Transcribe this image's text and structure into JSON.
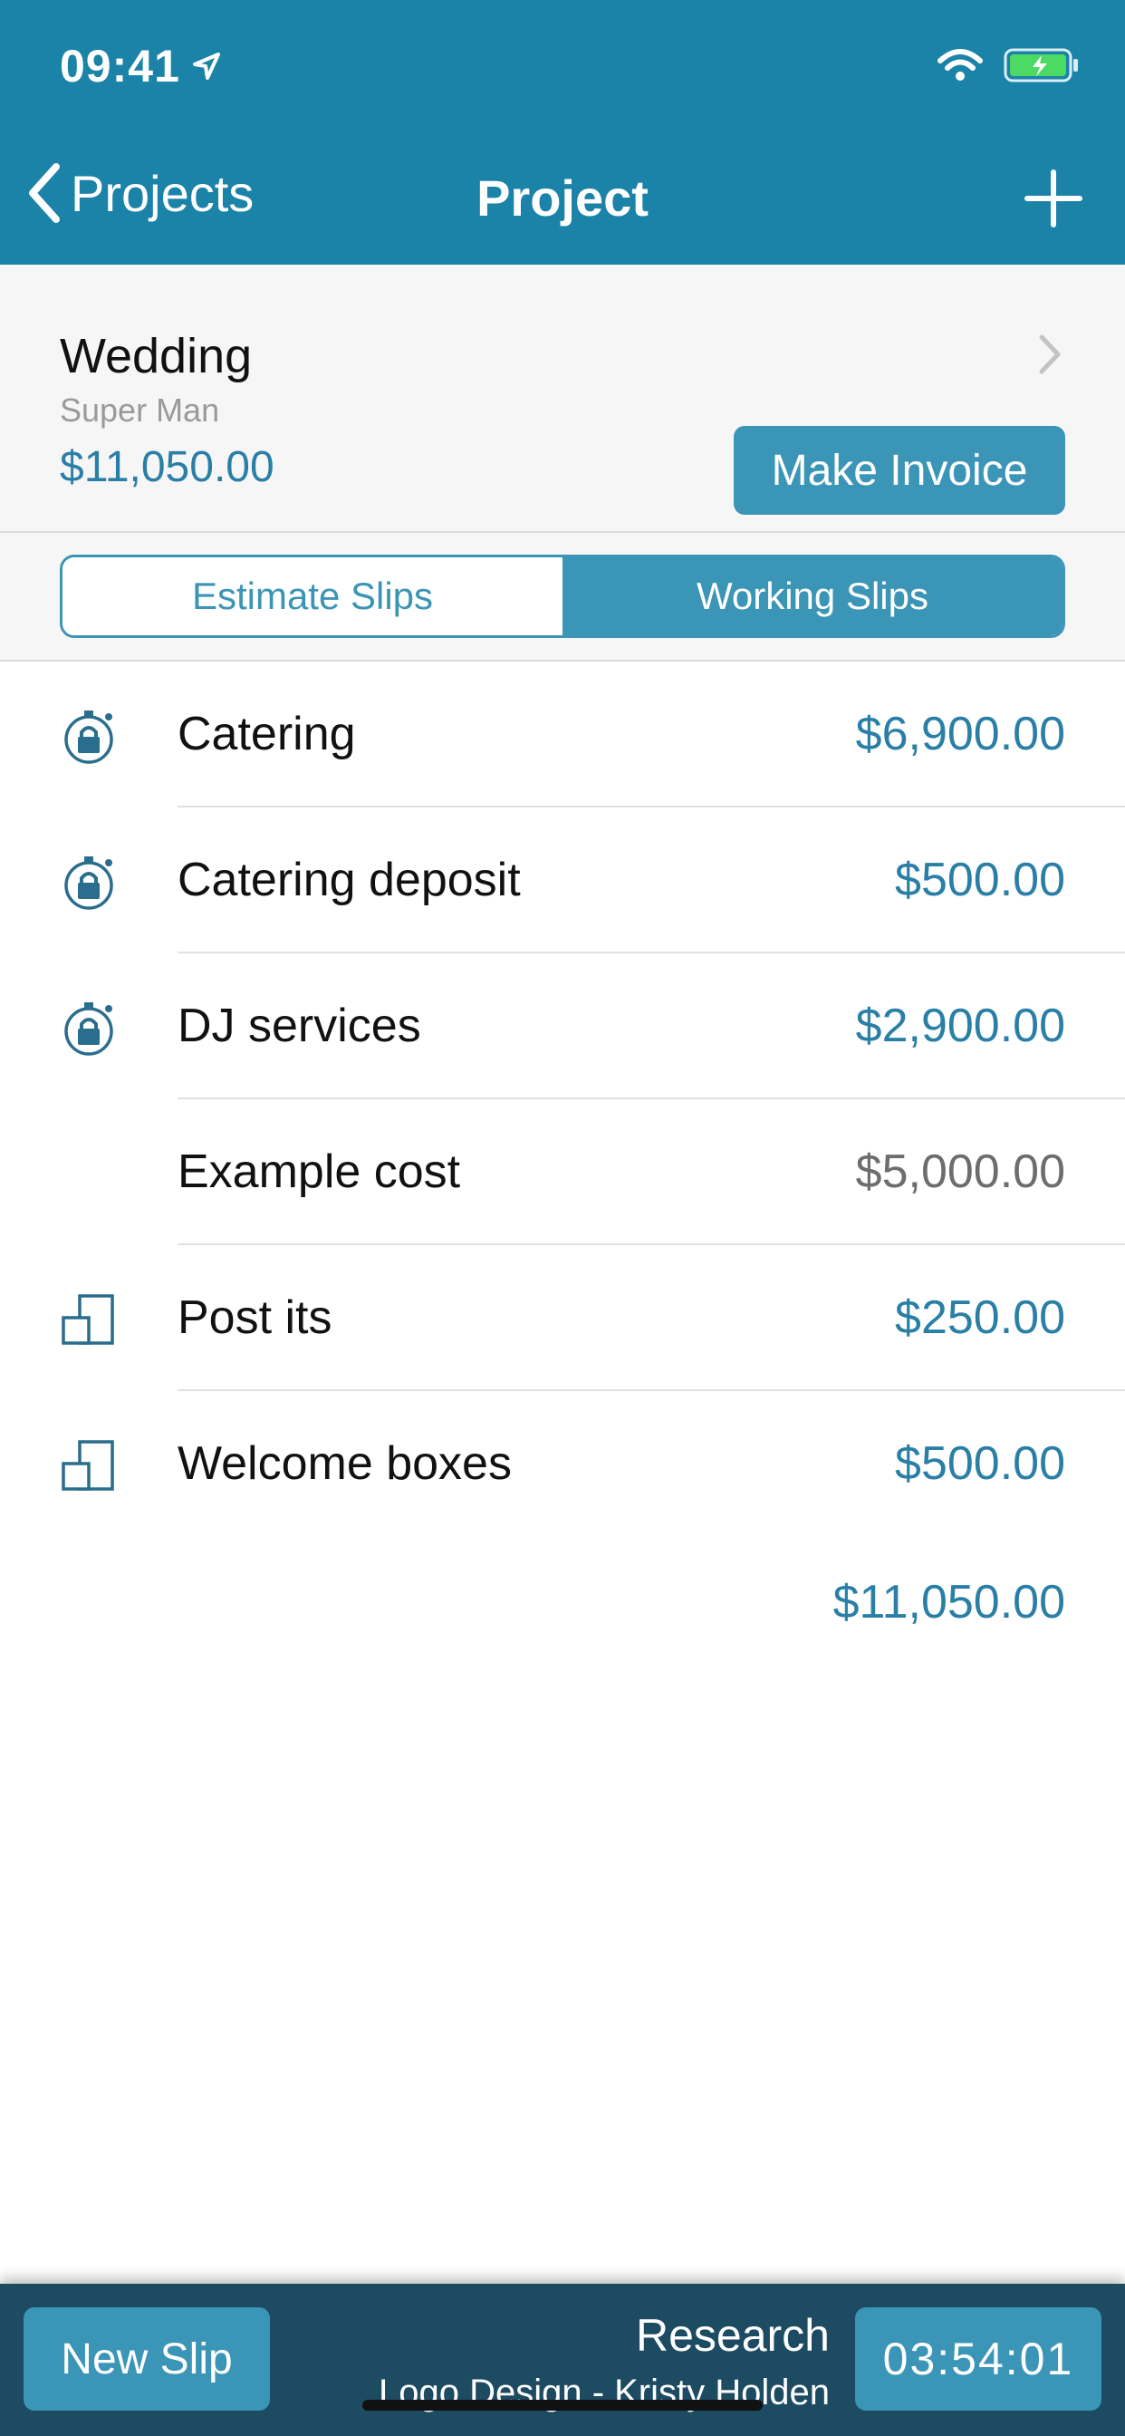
{
  "status_bar": {
    "time": "09:41"
  },
  "nav": {
    "back_label": "Projects",
    "title": "Project"
  },
  "project": {
    "name": "Wedding",
    "client": "Super Man",
    "total": "$11,050.00",
    "make_invoice_label": "Make Invoice"
  },
  "segments": {
    "estimate_label": "Estimate Slips",
    "working_label": "Working Slips",
    "selected": "Working Slips"
  },
  "slips": [
    {
      "icon": "timer-icon",
      "title": "Catering",
      "amount": "$6,900.00",
      "type": "timer"
    },
    {
      "icon": "timer-icon",
      "title": "Catering deposit",
      "amount": "$500.00",
      "type": "timer"
    },
    {
      "icon": "timer-icon",
      "title": "DJ services",
      "amount": "$2,900.00",
      "type": "timer"
    },
    {
      "icon": "",
      "title": "Example cost",
      "amount": "$5,000.00",
      "type": "cost"
    },
    {
      "icon": "item-icon",
      "title": "Post its",
      "amount": "$250.00",
      "type": "item"
    },
    {
      "icon": "item-icon",
      "title": "Welcome boxes",
      "amount": "$500.00",
      "type": "item"
    }
  ],
  "list_total": "$11,050.00",
  "timer_bar": {
    "new_slip_label": "New Slip",
    "task": "Research",
    "project": "Logo Design - Kristy Holden",
    "elapsed": "03:54:01"
  },
  "colors": {
    "header": "#1b82a8",
    "accent": "#3b95b6",
    "amount": "#2a7fa6",
    "timer_bar": "#1d4b62"
  }
}
